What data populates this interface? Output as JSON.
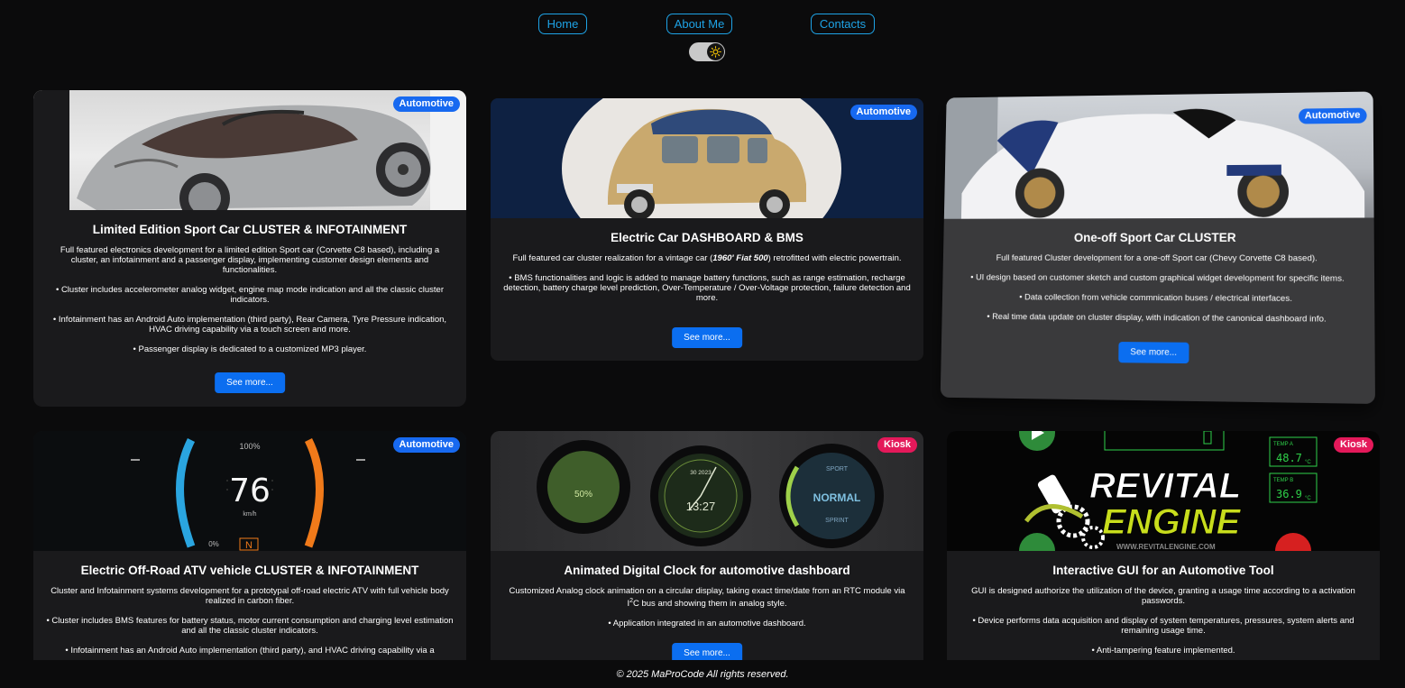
{
  "nav": {
    "home": "Home",
    "about": "About Me",
    "contacts": "Contacts"
  },
  "theme_toggle": {
    "icon": "sun-icon",
    "state": "dark"
  },
  "colors": {
    "accent": "#1ea3e6",
    "button": "#0b6ef0",
    "badge_automotive": "#1769f0",
    "badge_kiosk": "#e4195a",
    "card_bg": "#1a1a1c",
    "page_bg": "#0b0b0c"
  },
  "cards": [
    {
      "badge": "Automotive",
      "title": "Limited Edition Sport Car CLUSTER & INFOTAINMENT",
      "desc": [
        "Full featured electronics development for a limited edition Sport car (Corvette C8 based), including a cluster, an infotainment and a passenger display, implementing customer design elements and functionalities.",
        "• Cluster includes accelerometer analog widget, engine map mode indication and all the classic cluster indicators.",
        "• Infotainment has an Android Auto implementation (third party), Rear Camera, Tyre Pressure indication, HVAC driving capability via a touch screen and more.",
        "• Passenger display is dedicated to a customized MP3 player."
      ],
      "button": "See more..."
    },
    {
      "badge": "Automotive",
      "title": "Electric Car DASHBOARD & BMS",
      "desc_pre": "Full featured car cluster realization for a vintage car (",
      "desc_em": "1960' Fiat 500",
      "desc_post": ") retrofitted with electric powertrain.",
      "desc": [
        "• BMS functionalities and logic is added to manage battery functions, such as range estimation, recharge detection, battery charge level prediction, Over-Temperature / Over-Voltage protection, failure detection and more."
      ],
      "button": "See more..."
    },
    {
      "badge": "Automotive",
      "title": "One-off Sport Car CLUSTER",
      "desc": [
        "Full featured Cluster development for a one-off Sport car (Chevy Corvette C8 based).",
        "• UI design based on customer sketch and custom graphical widget development for specific items.",
        "• Data collection from vehicle commnication buses / electrical interfaces.",
        "• Real time data update on cluster display, with indication of the canonical dashboard info."
      ],
      "button": "See more..."
    },
    {
      "badge": "Automotive",
      "title": "Electric Off-Road ATV vehicle CLUSTER & INFOTAINMENT",
      "desc": [
        "Cluster and Infotainment systems development for a prototypal off-road electric ATV with full vehicle body realized in carbon fiber.",
        "• Cluster includes BMS features for battery status, motor current consumption and charging level estimation and all the classic cluster indicators.",
        "• Infotainment has an Android Auto implementation (third party), and HVAC driving capability via a"
      ],
      "dash": {
        "speed": "76",
        "unit": "km/h",
        "top": "100%",
        "bottom": "0%",
        "gear": "N"
      }
    },
    {
      "badge": "Kiosk",
      "title": "Animated Digital Clock for automotive dashboard",
      "desc_clock_pre": "Customized Analog clock animation on a circular display, taking exact time/date from an RTC module via I",
      "desc_clock_sup": "2",
      "desc_clock_post": "C bus and showing them in analog style.",
      "desc": [
        "• Application integrated in an automotive dashboard."
      ],
      "button": "See more...",
      "gauges": {
        "left_value": "50%",
        "center_time": "13:27",
        "center_date": "30 2023",
        "right_label": "NORMAL",
        "right_top": "SPORT",
        "right_bottom": "SPRINT"
      }
    },
    {
      "badge": "Kiosk",
      "title": "Interactive GUI for an Automotive Tool",
      "desc": [
        "GUI is designed authorize the utilization of the device, granting a usage time according to a activation passwords.",
        "• Device performs data acquisition and display of system temperatures, pressures, system alerts and remaining usage time.",
        "• Anti-tampering feature implemented."
      ],
      "logo": {
        "line1": "REVITAL",
        "line2": "ENGINE",
        "url": "WWW.REVITALENGINE.COM",
        "temp_a": "48.7",
        "temp_b": "36.9",
        "temp_a_label": "TEMP A",
        "temp_b_label": "TEMP B",
        "unit": "°C"
      }
    }
  ],
  "footer": "© 2025 MaProCode All rights reserved."
}
